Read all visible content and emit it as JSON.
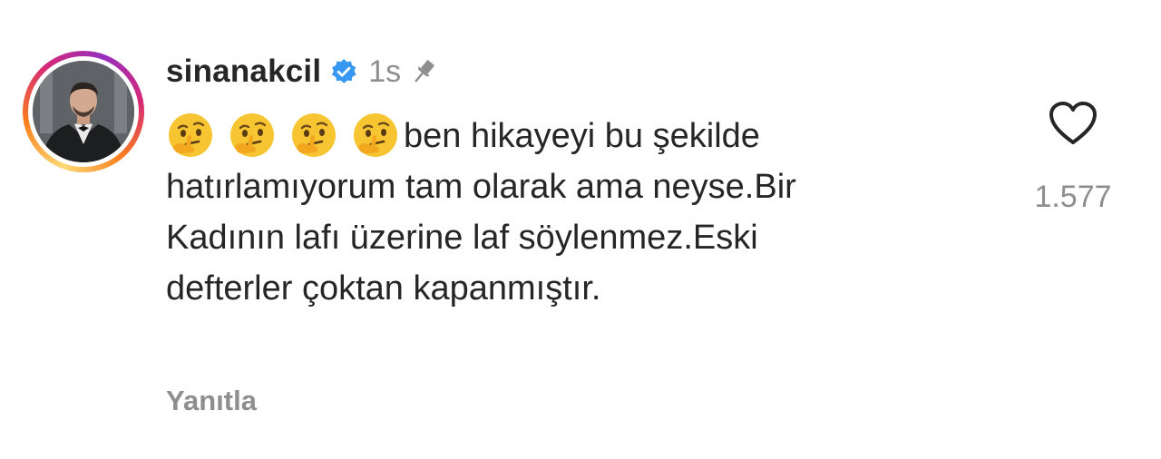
{
  "comment": {
    "username": "sinanakcil",
    "verified_icon": "verified-badge-icon",
    "time": "1s",
    "pinned_icon": "pin-icon",
    "emojis": [
      "thinking-face-emoji",
      "thinking-face-emoji",
      "thinking-face-emoji",
      "thinking-face-emoji"
    ],
    "text_lines": [
      "ben hikayeyi bu şekilde",
      "hatırlamıyorum tam olarak ama neyse.Bir",
      "Kadının lafı üzerine laf söylenmez.Eski",
      "defterler çoktan kapanmıştır."
    ],
    "reply_label": "Yanıtla",
    "like_icon": "heart-icon",
    "like_count": "1.577"
  },
  "colors": {
    "text": "#262626",
    "secondary": "#8e8e8e",
    "verified": "#3897f0"
  }
}
